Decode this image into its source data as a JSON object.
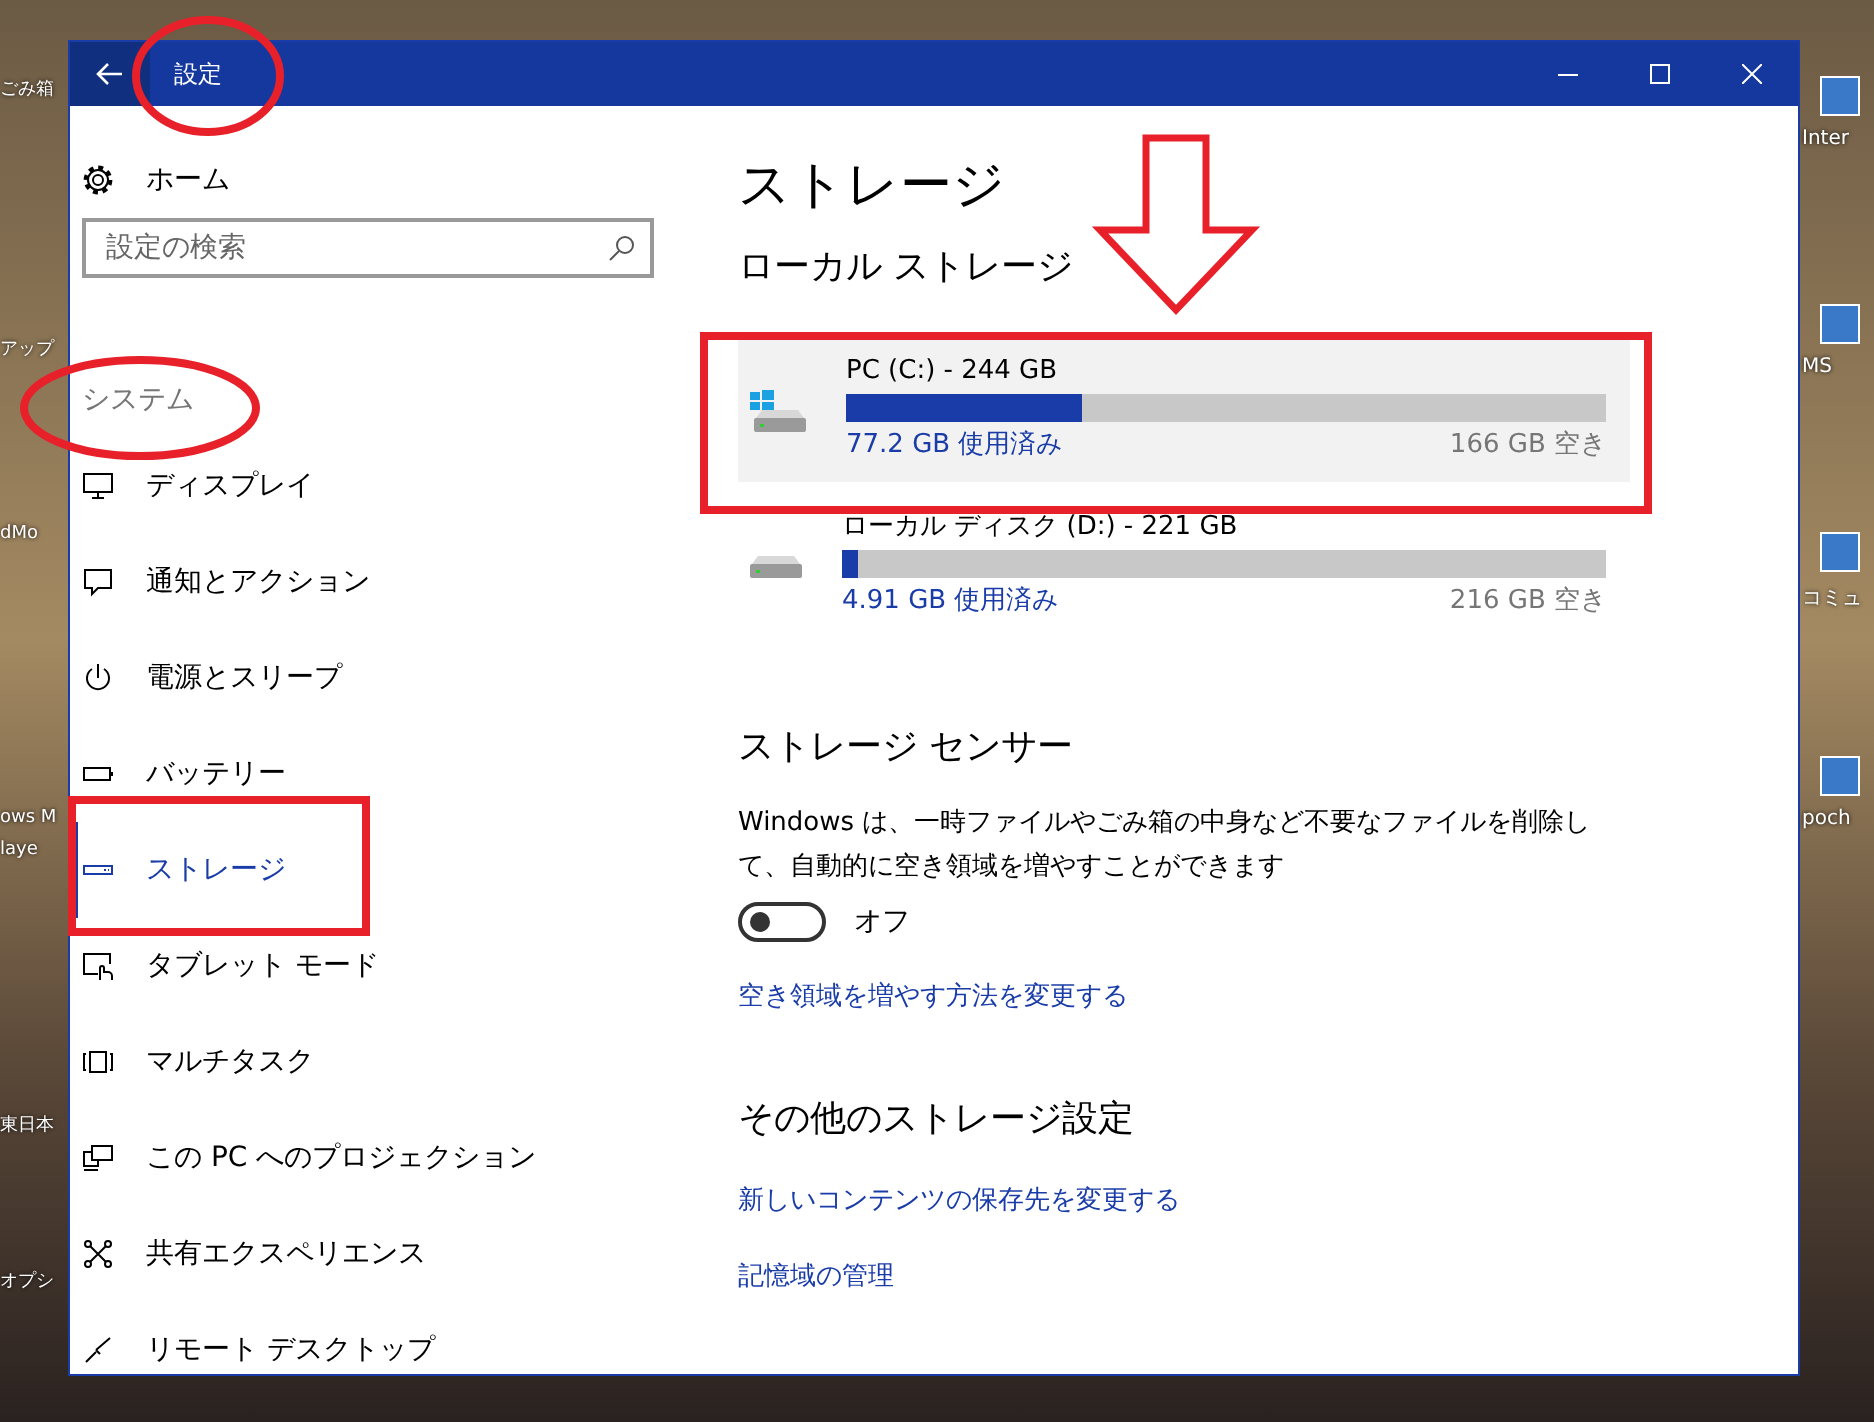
{
  "desktop": {
    "left_labels": [
      {
        "label": "ごみ箱"
      },
      {
        "label": "アップ"
      },
      {
        "label": "dMo"
      },
      {
        "label": "ows M"
      },
      {
        "label": "laye"
      },
      {
        "label": "東日本"
      },
      {
        "label": "オプシ"
      }
    ],
    "right_labels": [
      {
        "label": "Inter"
      },
      {
        "label": "MS"
      },
      {
        "label": "コミュ"
      },
      {
        "label": "poch"
      }
    ]
  },
  "window": {
    "title": "設定"
  },
  "sidebar": {
    "home": "ホーム",
    "search": {
      "placeholder": "設定の検索"
    },
    "section": "システム",
    "items": [
      {
        "label": "ディスプレイ",
        "kind": "display",
        "selected": false
      },
      {
        "label": "通知とアクション",
        "kind": "notifications",
        "selected": false
      },
      {
        "label": "電源とスリープ",
        "kind": "power",
        "selected": false
      },
      {
        "label": "バッテリー",
        "kind": "battery",
        "selected": false
      },
      {
        "label": "ストレージ",
        "kind": "storage",
        "selected": true
      },
      {
        "label": "タブレット モード",
        "kind": "tablet",
        "selected": false
      },
      {
        "label": "マルチタスク",
        "kind": "multitask",
        "selected": false
      },
      {
        "label": "この PC へのプロジェクション",
        "kind": "projection",
        "selected": false
      },
      {
        "label": "共有エクスペリエンス",
        "kind": "shared",
        "selected": false
      },
      {
        "label": "リモート デスクトップ",
        "kind": "remote",
        "selected": false
      }
    ]
  },
  "content": {
    "title": "ストレージ",
    "local_heading": "ローカル ストレージ",
    "drives": [
      {
        "name": "PC (C:) - 244 GB",
        "kind": "system",
        "highlighted": true,
        "level": 0.31,
        "used": "77.2 GB 使用済み",
        "free": "166 GB 空き"
      },
      {
        "name": "ローカル ディスク (D:) - 221 GB",
        "kind": "data",
        "highlighted": false,
        "level": 0.022,
        "used": "4.91 GB 使用済み",
        "free": "216 GB 空き"
      }
    ],
    "sensor": {
      "heading": "ストレージ センサー",
      "description": "Windows は、一時ファイルやごみ箱の中身など不要なファイルを削除して、自動的に空き領域を増やすことができます",
      "toggle": {
        "on": false,
        "label": "オフ"
      },
      "link": "空き領域を増やす方法を変更する"
    },
    "other": {
      "heading": "その他のストレージ設定",
      "links": [
        "新しいコンテンツの保存先を変更する",
        "記憶域の管理"
      ]
    }
  }
}
